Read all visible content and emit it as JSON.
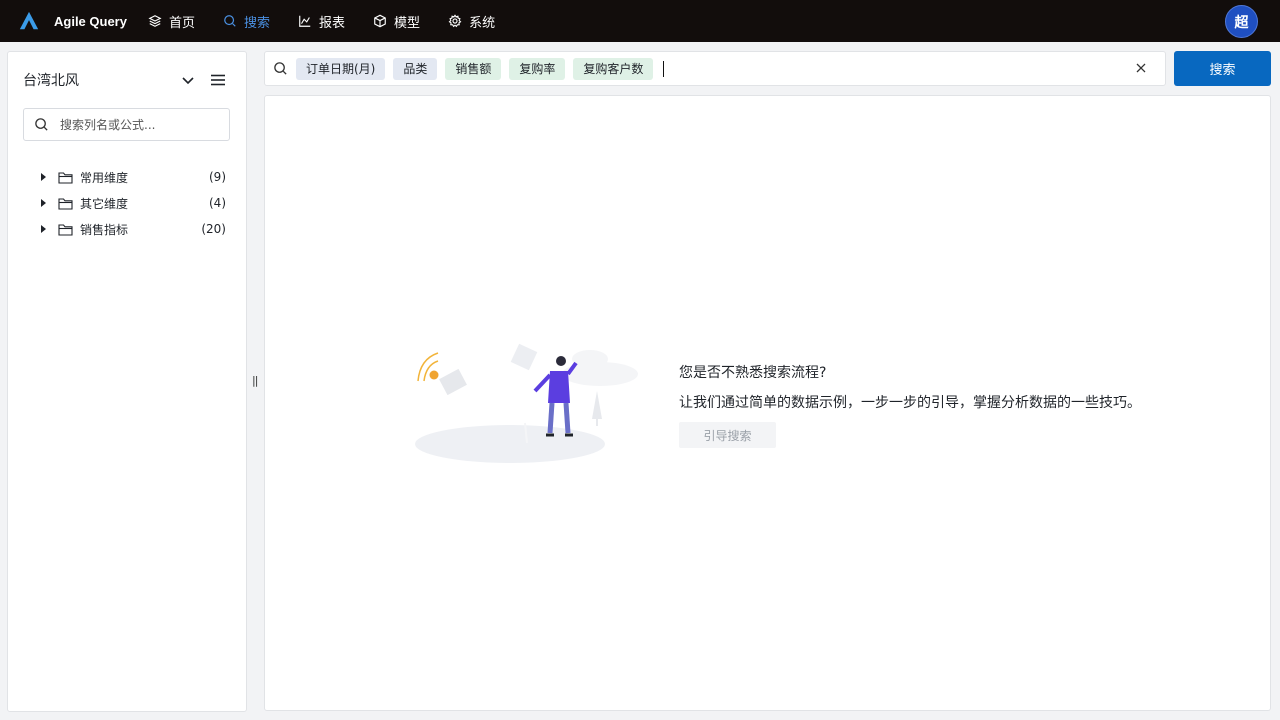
{
  "app": {
    "name": "Agile Query",
    "user_avatar": "超",
    "accent": "#0868c0",
    "topbar_bg": "#120d0c"
  },
  "nav": [
    {
      "label": "首页",
      "icon": "layers-icon",
      "active": false
    },
    {
      "label": "搜索",
      "icon": "search-icon",
      "active": true
    },
    {
      "label": "报表",
      "icon": "chart-icon",
      "active": false
    },
    {
      "label": "模型",
      "icon": "cube-icon",
      "active": false
    },
    {
      "label": "系统",
      "icon": "gear-icon",
      "active": false
    }
  ],
  "sidebar": {
    "title": "台湾北风",
    "search_placeholder": "搜索列名或公式...",
    "tree": [
      {
        "label": "常用维度",
        "count": "(9)"
      },
      {
        "label": "其它维度",
        "count": "(4)"
      },
      {
        "label": "销售指标",
        "count": "(20)"
      }
    ]
  },
  "search": {
    "chips": [
      {
        "label": "订单日期(月)",
        "kind": "dimension"
      },
      {
        "label": "品类",
        "kind": "dimension"
      },
      {
        "label": "销售额",
        "kind": "measure"
      },
      {
        "label": "复购率",
        "kind": "measure"
      },
      {
        "label": "复购客户数",
        "kind": "measure"
      }
    ],
    "button_label": "搜索"
  },
  "guide": {
    "title": "您是否不熟悉搜索流程?",
    "description": "让我们通过简单的数据示例，一步一步的引导，掌握分析数据的一些技巧。",
    "button_label": "引导搜索"
  },
  "splitter": "||"
}
